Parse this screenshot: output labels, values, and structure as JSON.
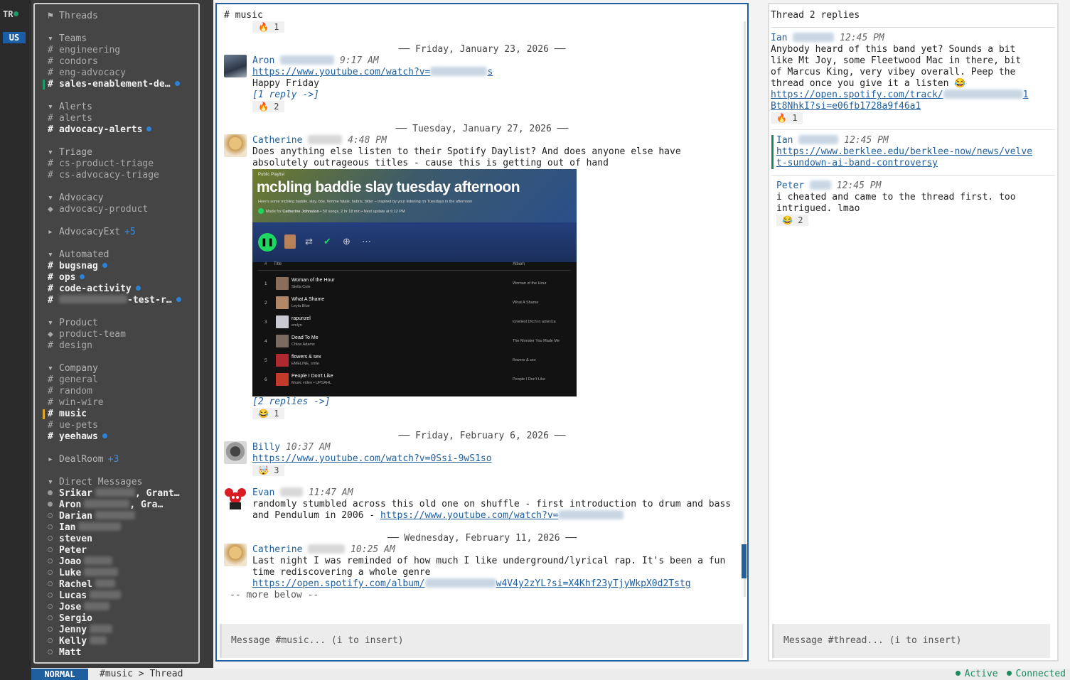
{
  "rail": {
    "ws1": "TR",
    "ws2": "US"
  },
  "sidebar": {
    "threads": "Threads",
    "sections": {
      "teams": "Teams",
      "alerts": "Alerts",
      "triage": "Triage",
      "advocacy": "Advocacy",
      "advocacy_ext": "AdvocacyExt",
      "advocacy_ext_more": "+5",
      "automated": "Automated",
      "product": "Product",
      "company": "Company",
      "dealroom": "DealRoom",
      "dealroom_more": "+3",
      "dms": "Direct Messages"
    },
    "channels": {
      "engineering": "engineering",
      "condors": "condors",
      "eng_advocacy": "eng-advocacy",
      "sales_enablement": "sales-enablement-de…",
      "alerts": "alerts",
      "advocacy_alerts": "advocacy-alerts",
      "cs_product_triage": "cs-product-triage",
      "cs_advocacy_triage": "cs-advocacy-triage",
      "advocacy_product": "advocacy-product",
      "bugsnag": "bugsnag",
      "ops": "ops",
      "code_activity": "code-activity",
      "test_r": "-test-r…",
      "product_team": "product-team",
      "design": "design",
      "general": "general",
      "random": "random",
      "win_wire": "win-wire",
      "music": "music",
      "ue_pets": "ue-pets",
      "yeehaws": "yeehaws"
    },
    "dms": {
      "srikar": "Srikar",
      "srikar_rest": ", Grant…",
      "aron": "Aron",
      "aron_rest": ", Gra…",
      "darian": "Darian",
      "ian": "Ian",
      "steven": "steven",
      "peter": "Peter",
      "joao": "Joao",
      "luke": "Luke",
      "rachel": "Rachel",
      "lucas": "Lucas",
      "jose": "Jose",
      "sergio": "Sergio",
      "jenny": "Jenny",
      "kelly": "Kelly",
      "matt": "Matt"
    }
  },
  "main": {
    "channel_title": "# music",
    "channel_reaction_count": "1",
    "more_below": "-- more below --",
    "composer_placeholder": "Message #music... (i to insert)",
    "date1": "── Friday, January 23, 2026 ──",
    "date2": "── Tuesday, January 27, 2026 ──",
    "date3": "── Friday, February 6, 2026 ──",
    "date4": "── Wednesday, February 11, 2026 ──",
    "m1": {
      "author": "Aron",
      "time": "9:17 AM",
      "link": "https://www.youtube.com/watch?v=",
      "link_tail": "s",
      "text": "Happy Friday",
      "replies": "[1 reply ->]",
      "reaction_count": "2"
    },
    "m2": {
      "author": "Catherine",
      "time": "4:48 PM",
      "text1": "Does anything else listen to their Spotify Daylist? And does anyone else have",
      "text2": "absolutely outrageous titles - cause this is getting out of hand",
      "replies": "[2 replies ->]",
      "reaction_count": "1"
    },
    "m3": {
      "author": "Billy",
      "time": "10:37 AM",
      "link": "https://www.youtube.com/watch?v=0Ssi-9wS1so",
      "reaction_count": "3"
    },
    "m4": {
      "author": "Evan",
      "time": "11:47 AM",
      "text1": "randomly stumbled across this old one on shuffle - first introduction to drum and bass",
      "text2": "and Pendulum in 2006 - ",
      "link": "https://www.youtube.com/watch?v="
    },
    "m5": {
      "author": "Catherine",
      "time": "10:25 AM",
      "text1": "Last night I was reminded of how much I like underground/lyrical rap. It's been a fun",
      "text2": "time rediscovering a whole genre",
      "link_start": "https://open.spotify.com/album/",
      "link_end": "w4V4y2zYL?si=X4Khf23yTjyWkpX0d2Tstg"
    }
  },
  "spotify": {
    "kind": "Public Playlist",
    "title": "mcbling baddie slay tuesday afternoon",
    "description": "Here's some mcbling baddie, slay, bbe, femme fatale, hubris, bitter – inspired by your listening on Tuesdays in the afternoon",
    "made_for": "Made for",
    "user": "Catherine Johnston",
    "stats": " • 50 songs, 2 hr 18 min • Next update at 6:12 PM",
    "col_num": "#",
    "col_title": "Title",
    "col_album": "Album",
    "tracks": [
      {
        "n": "1",
        "title": "Woman of the Hour",
        "artist": "Stella Cole",
        "album": "Woman of the Hour",
        "color": "#8a6e5a"
      },
      {
        "n": "2",
        "title": "What A Shame",
        "artist": "Leyla Blue",
        "album": "What A Shame",
        "color": "#b08868"
      },
      {
        "n": "3",
        "title": "rapunzel",
        "artist": "emlyn",
        "album": "loneliest b!tch in america",
        "color": "#c9c9d2"
      },
      {
        "n": "4",
        "title": "Dead To Me",
        "artist": "Chloe Adams",
        "album": "The Monster You Made Me",
        "color": "#7a6a62"
      },
      {
        "n": "5",
        "title": "flowers & sex",
        "artist": "EMELINE, smle",
        "album": "flowers & sex",
        "color": "#b02830"
      },
      {
        "n": "6",
        "title": "People I Don't Like",
        "artist": "Music video • UPSAHL",
        "album": "People I Don't Like",
        "color": "#c23a2a"
      }
    ]
  },
  "thread": {
    "title": "Thread",
    "count": "2 replies",
    "composer_placeholder": "Message #thread... (i to insert)",
    "root": {
      "author": "Ian",
      "time": "12:45 PM",
      "l1": "Anybody heard of this band yet? Sounds a bit",
      "l2": "like Mt Joy, some Fleetwood Mac in there, bit",
      "l3": "of Marcus King, very vibey overall. Peep the",
      "l4": "thread once you give it a listen 😂",
      "link1": "https://open.spotify.com/track/",
      "link1_end": "1",
      "link2_pre": "B",
      "link2": "t8NhkI?si=e06fb1728a9f46a1",
      "reaction_count": "1"
    },
    "r1": {
      "author": "Ian",
      "time": "12:45 PM",
      "link1": "https://www.berklee.edu/berklee-now/news/velve",
      "link2": "t-sundown-ai-band-controversy"
    },
    "r2": {
      "author": "Peter",
      "time": "12:45 PM",
      "l1": "i cheated and came to the thread first. too",
      "l2": "intrigued. lmao",
      "reaction_count": "2"
    }
  },
  "status": {
    "mode": "NORMAL",
    "crumb": "#music > Thread",
    "active": "Active",
    "connected": "Connected"
  },
  "colors": {
    "accent": "#1f5fa0",
    "unread": "#2d82d6",
    "online": "#1a8a5e"
  }
}
